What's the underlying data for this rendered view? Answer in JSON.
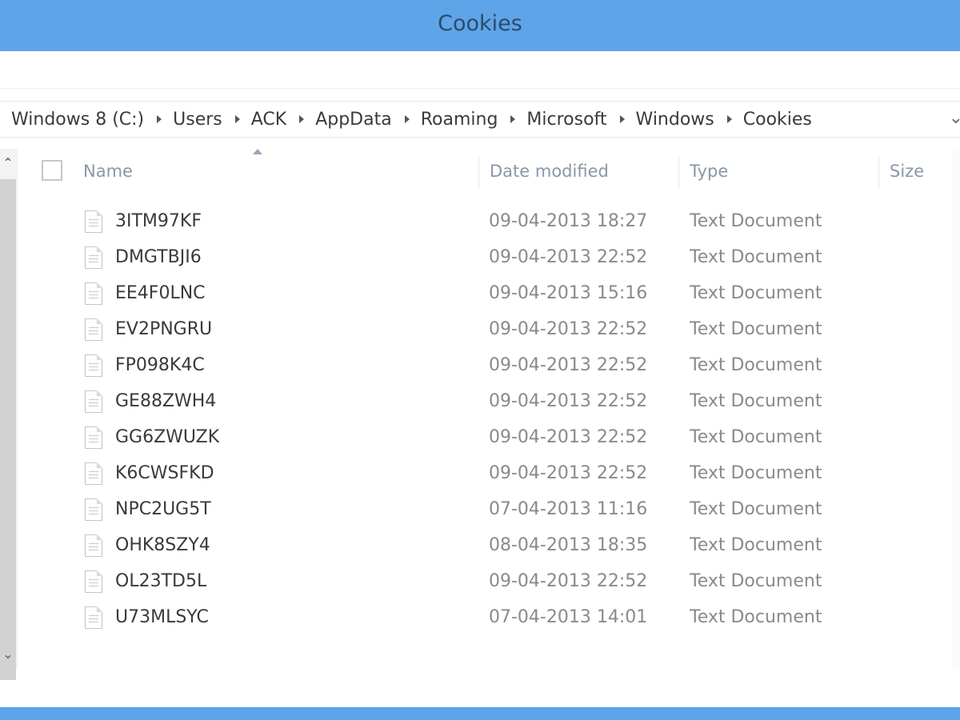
{
  "window": {
    "title": "Cookies",
    "accent_color": "#5ea4e8"
  },
  "breadcrumb": {
    "items": [
      "Windows 8 (C:)",
      "Users",
      "ACK",
      "AppData",
      "Roaming",
      "Microsoft",
      "Windows",
      "Cookies"
    ],
    "dropdown_icon": "chevron-down-icon"
  },
  "columns": {
    "name": "Name",
    "date_modified": "Date modified",
    "type": "Type",
    "size": "Size"
  },
  "files": [
    {
      "name": "3ITM97KF",
      "date": "09-04-2013 18:27",
      "type": "Text Document"
    },
    {
      "name": "DMGTBJI6",
      "date": "09-04-2013 22:52",
      "type": "Text Document"
    },
    {
      "name": "EE4F0LNC",
      "date": "09-04-2013 15:16",
      "type": "Text Document"
    },
    {
      "name": "EV2PNGRU",
      "date": "09-04-2013 22:52",
      "type": "Text Document"
    },
    {
      "name": "FP098K4C",
      "date": "09-04-2013 22:52",
      "type": "Text Document"
    },
    {
      "name": "GE88ZWH4",
      "date": "09-04-2013 22:52",
      "type": "Text Document"
    },
    {
      "name": "GG6ZWUZK",
      "date": "09-04-2013 22:52",
      "type": "Text Document"
    },
    {
      "name": "K6CWSFKD",
      "date": "09-04-2013 22:52",
      "type": "Text Document"
    },
    {
      "name": "NPC2UG5T",
      "date": "07-04-2013 11:16",
      "type": "Text Document"
    },
    {
      "name": "OHK8SZY4",
      "date": "08-04-2013 18:35",
      "type": "Text Document"
    },
    {
      "name": "OL23TD5L",
      "date": "09-04-2013 22:52",
      "type": "Text Document"
    },
    {
      "name": "U73MLSYC",
      "date": "07-04-2013 14:01",
      "type": "Text Document"
    }
  ]
}
